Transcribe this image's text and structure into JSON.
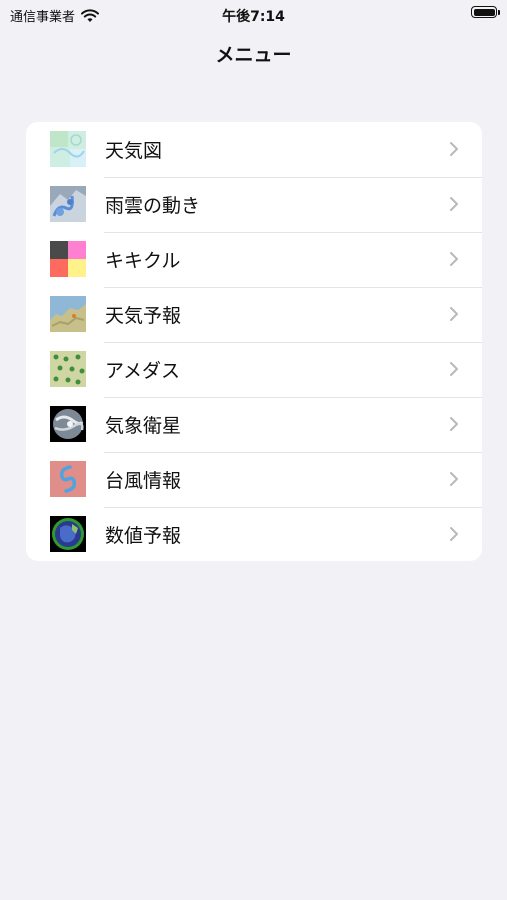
{
  "status_bar": {
    "carrier": "通信事業者",
    "time": "午後7:14"
  },
  "nav": {
    "title": "メニュー"
  },
  "menu": {
    "items": [
      {
        "label": "天気図",
        "icon": "weather-map-icon"
      },
      {
        "label": "雨雲の動き",
        "icon": "rain-cloud-radar-icon"
      },
      {
        "label": "キキクル",
        "icon": "kikikuru-icon"
      },
      {
        "label": "天気予報",
        "icon": "forecast-map-icon"
      },
      {
        "label": "アメダス",
        "icon": "amedas-map-icon"
      },
      {
        "label": "気象衛星",
        "icon": "satellite-earth-icon"
      },
      {
        "label": "台風情報",
        "icon": "typhoon-icon"
      },
      {
        "label": "数値予報",
        "icon": "numerical-forecast-icon"
      }
    ]
  },
  "colors": {
    "background": "#f1f1f6",
    "card": "#ffffff",
    "chevron": "#b8b8bd"
  }
}
